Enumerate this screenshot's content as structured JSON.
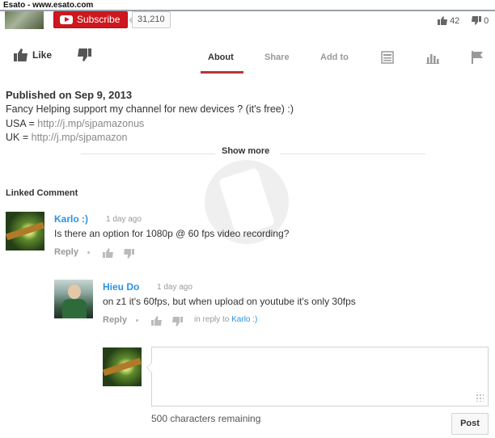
{
  "window": {
    "title": "Esato - www.esato.com"
  },
  "channel": {
    "subscribe_label": "Subscribe",
    "subscriber_count": "31,210",
    "like_count": "42",
    "dislike_count": "0"
  },
  "actions": {
    "like_label": "Like",
    "tabs": [
      {
        "label": "About",
        "active": true
      },
      {
        "label": "Share",
        "active": false
      },
      {
        "label": "Add to",
        "active": false
      }
    ],
    "icons": [
      "transcript-icon",
      "stats-icon",
      "flag-icon"
    ]
  },
  "description": {
    "published": "Published on Sep 9, 2013",
    "line1": "Fancy Helping support my channel for new devices ? (it's free) :)",
    "line2_prefix": "USA = ",
    "line2_link": "http://j.mp/sjpamazonus",
    "line3_prefix": "UK = ",
    "line3_link": "http://j.mp/sjpamazon",
    "show_more": "Show more"
  },
  "comments": {
    "heading": "Linked Comment",
    "items": [
      {
        "author": "Karlo :)",
        "time": "1 day ago",
        "text": "Is there an option for 1080p @ 60 fps video recording?",
        "reply_label": "Reply"
      },
      {
        "author": "Hieu Do",
        "time": "1 day ago",
        "text": "on z1 it's 60fps, but when upload on youtube it's only 30fps",
        "reply_label": "Reply",
        "in_reply_prefix": "in reply to",
        "in_reply_to": "Karlo :)"
      }
    ],
    "composer": {
      "placeholder": "",
      "chars_remaining": "500 characters remaining",
      "post_label": "Post"
    }
  },
  "colors": {
    "subscribe_red": "#cc181e",
    "active_tab_underline": "#b2373a",
    "author_blue": "#2793e6"
  }
}
